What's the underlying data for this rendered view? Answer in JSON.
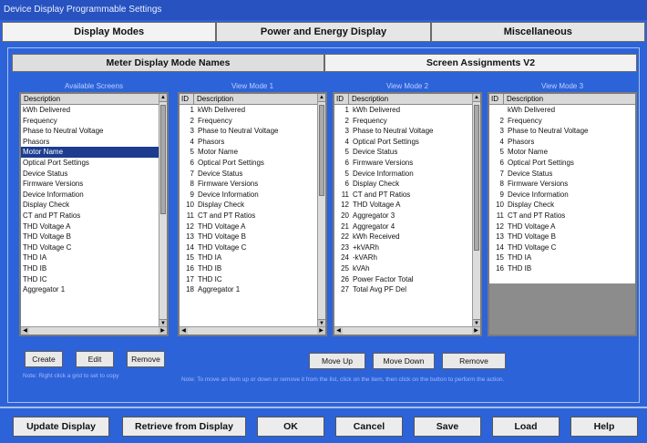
{
  "window": {
    "title": "Device Display Programmable Settings"
  },
  "main_tabs": [
    "Display Modes",
    "Power and Energy Display",
    "Miscellaneous"
  ],
  "sub_tabs": [
    "Meter Display Mode Names",
    "Screen Assignments V2"
  ],
  "available": {
    "title": "Available Screens",
    "header": "Description",
    "items": [
      "kWh Delivered",
      "Frequency",
      "Phase to Neutral Voltage",
      "Phasors",
      "Motor Name",
      "Optical Port Settings",
      "Device Status",
      "Firmware Versions",
      "Device Information",
      "Display Check",
      "CT and PT Ratios",
      "THD Voltage A",
      "THD Voltage B",
      "THD Voltage C",
      "THD IA",
      "THD IB",
      "THD IC",
      "Aggregator 1"
    ],
    "selected_index": 4,
    "buttons": [
      "Create",
      "Edit",
      "Remove"
    ],
    "note": "Note: Right click a grid to set to copy"
  },
  "mode1": {
    "title": "View Mode 1",
    "header_id": "ID",
    "header_desc": "Description",
    "items": [
      [
        "1",
        "kWh Delivered"
      ],
      [
        "2",
        "Frequency"
      ],
      [
        "3",
        "Phase to Neutral Voltage"
      ],
      [
        "4",
        "Phasors"
      ],
      [
        "5",
        "Motor Name"
      ],
      [
        "6",
        "Optical Port Settings"
      ],
      [
        "7",
        "Device Status"
      ],
      [
        "8",
        "Firmware Versions"
      ],
      [
        "9",
        "Device Information"
      ],
      [
        "10",
        "Display Check"
      ],
      [
        "11",
        "CT and PT Ratios"
      ],
      [
        "12",
        "THD Voltage A"
      ],
      [
        "13",
        "THD Voltage B"
      ],
      [
        "14",
        "THD Voltage C"
      ],
      [
        "15",
        "THD IA"
      ],
      [
        "16",
        "THD IB"
      ],
      [
        "17",
        "THD IC"
      ],
      [
        "18",
        "Aggregator 1"
      ]
    ]
  },
  "mode2": {
    "title": "View Mode 2",
    "header_id": "ID",
    "header_desc": "Description",
    "items": [
      [
        "1",
        "kWh Delivered"
      ],
      [
        "2",
        "Frequency"
      ],
      [
        "3",
        "Phase to Neutral Voltage"
      ],
      [
        "4",
        "Optical Port Settings"
      ],
      [
        "5",
        "Device Status"
      ],
      [
        "6",
        "Firmware Versions"
      ],
      [
        "5",
        "Device Information"
      ],
      [
        "6",
        "Display Check"
      ],
      [
        "11",
        "CT and PT Ratios"
      ],
      [
        "12",
        "THD Voltage A"
      ],
      [
        "20",
        "Aggregator 3"
      ],
      [
        "21",
        "Aggregator 4"
      ],
      [
        "22",
        "kWh Received"
      ],
      [
        "23",
        "+kVARh"
      ],
      [
        "24",
        "-kVARh"
      ],
      [
        "25",
        "kVAh"
      ],
      [
        "26",
        "Power Factor Total"
      ],
      [
        "27",
        "Total Avg PF Del"
      ]
    ]
  },
  "mode3": {
    "title": "View Mode 3",
    "header_id": "ID",
    "header_desc": "Description",
    "items": [
      [
        "",
        "kWh Delivered"
      ],
      [
        "2",
        "Frequency"
      ],
      [
        "3",
        "Phase to Neutral Voltage"
      ],
      [
        "4",
        "Phasors"
      ],
      [
        "5",
        "Motor Name"
      ],
      [
        "6",
        "Optical Port Settings"
      ],
      [
        "7",
        "Device Status"
      ],
      [
        "8",
        "Firmware Versions"
      ],
      [
        "9",
        "Device Information"
      ],
      [
        "10",
        "Display Check"
      ],
      [
        "11",
        "CT and PT Ratios"
      ],
      [
        "12",
        "THD Voltage A"
      ],
      [
        "13",
        "THD Voltage B"
      ],
      [
        "14",
        "THD Voltage C"
      ],
      [
        "15",
        "THD IA"
      ],
      [
        "16",
        "THD IB"
      ]
    ]
  },
  "mode_buttons": [
    "Move Up",
    "Move Down",
    "Remove"
  ],
  "mode_note": "Note: To move an item up or down or remove it from the list, click on the item, then click on the button to perform the action.",
  "bottom_buttons": [
    "Update Display",
    "Retrieve from Display",
    "OK",
    "Cancel",
    "Save",
    "Load",
    "Help"
  ]
}
